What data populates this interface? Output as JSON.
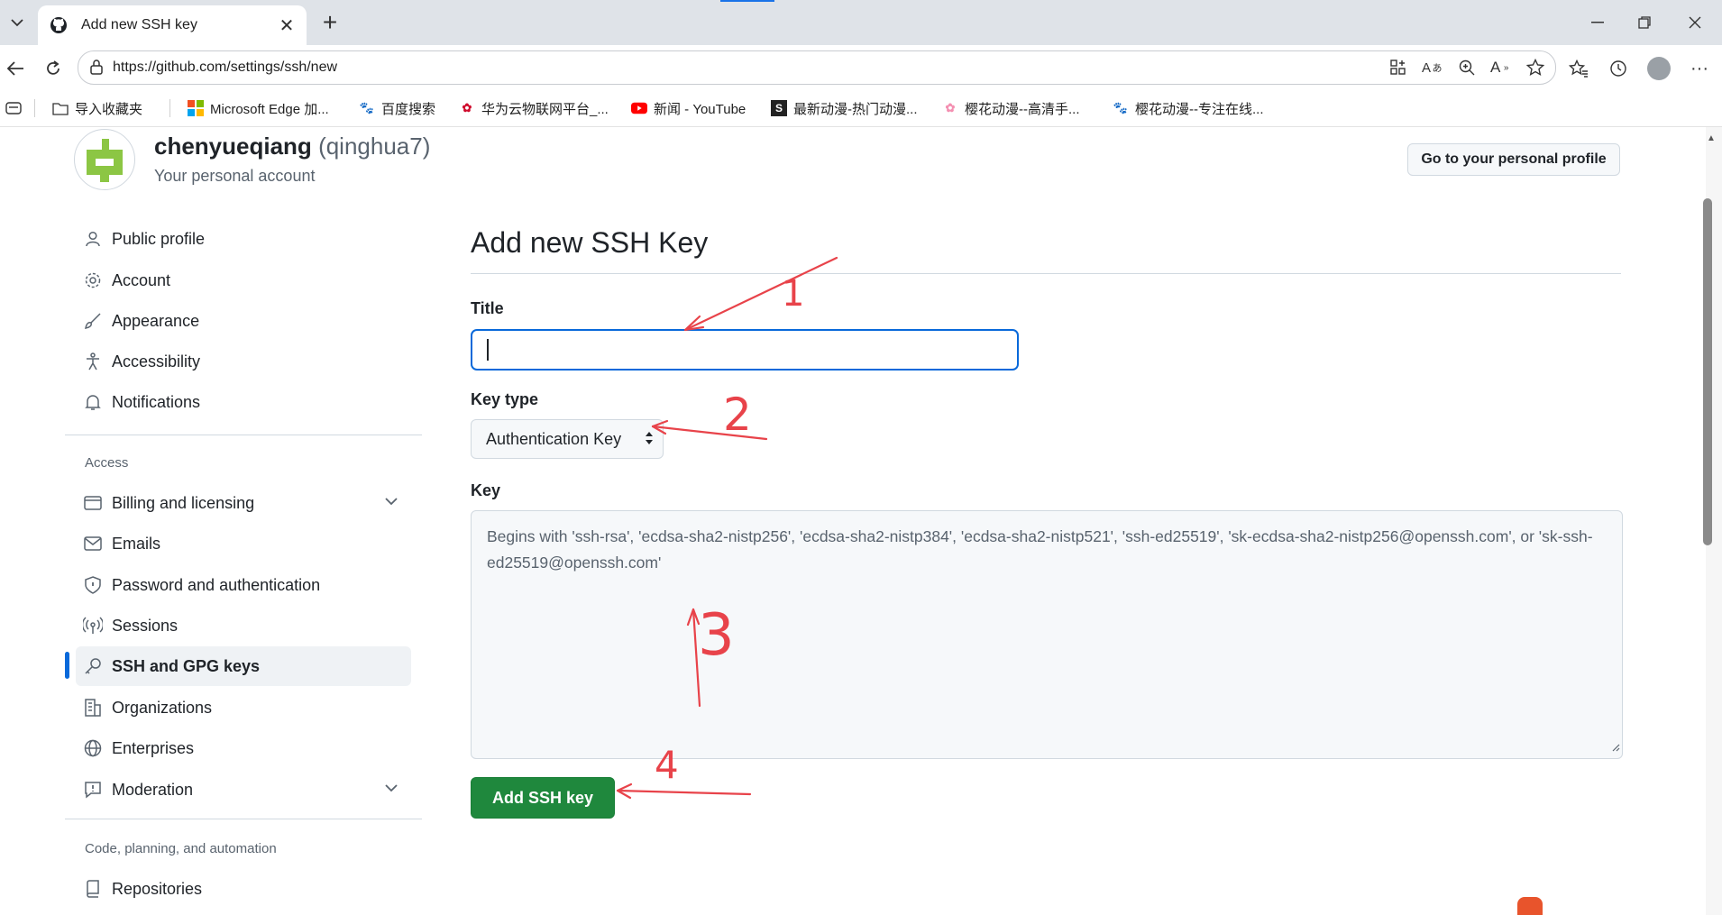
{
  "browser": {
    "tab_title": "Add new SSH key",
    "url": "https://github.com/settings/ssh/new",
    "favorites": [
      {
        "label": "导入收藏夹"
      },
      {
        "label": "Microsoft Edge 加..."
      },
      {
        "label": "百度搜索"
      },
      {
        "label": "华为云物联网平台_..."
      },
      {
        "label": "新闻 - YouTube"
      },
      {
        "label": "最新动漫-热门动漫..."
      },
      {
        "label": "樱花动漫--高清手..."
      },
      {
        "label": "樱花动漫--专注在线..."
      }
    ]
  },
  "account": {
    "name": "chenyueqiang",
    "login": "(qinghua7)",
    "subtitle": "Your personal account",
    "profile_button": "Go to your personal profile"
  },
  "sidebar": {
    "top_items": [
      {
        "label": "Public profile",
        "icon": "person-icon"
      },
      {
        "label": "Account",
        "icon": "gear-icon"
      },
      {
        "label": "Appearance",
        "icon": "paintbrush-icon"
      },
      {
        "label": "Accessibility",
        "icon": "accessibility-icon"
      },
      {
        "label": "Notifications",
        "icon": "bell-icon"
      }
    ],
    "access_heading": "Access",
    "access_items": [
      {
        "label": "Billing and licensing",
        "icon": "credit-card-icon"
      },
      {
        "label": "Emails",
        "icon": "mail-icon"
      },
      {
        "label": "Password and authentication",
        "icon": "shield-icon"
      },
      {
        "label": "Sessions",
        "icon": "broadcast-icon"
      },
      {
        "label": "SSH and GPG keys",
        "icon": "key-icon",
        "active": true
      },
      {
        "label": "Organizations",
        "icon": "organization-icon"
      },
      {
        "label": "Enterprises",
        "icon": "globe-icon"
      },
      {
        "label": "Moderation",
        "icon": "report-icon"
      }
    ],
    "code_heading": "Code, planning, and automation",
    "code_items": [
      {
        "label": "Repositories",
        "icon": "repo-icon"
      }
    ]
  },
  "form": {
    "heading": "Add new SSH Key",
    "title_label": "Title",
    "title_value": "",
    "keytype_label": "Key type",
    "keytype_value": "Authentication Key",
    "key_label": "Key",
    "key_placeholder": "Begins with 'ssh-rsa', 'ecdsa-sha2-nistp256', 'ecdsa-sha2-nistp384', 'ecdsa-sha2-nistp521', 'ssh-ed25519', 'sk-ecdsa-sha2-nistp256@openssh.com', or 'sk-ssh-ed25519@openssh.com'",
    "submit": "Add SSH key"
  },
  "annotations": [
    {
      "number": "1"
    },
    {
      "number": "2"
    },
    {
      "number": "3"
    },
    {
      "number": "4"
    }
  ],
  "colors": {
    "accent_blue": "#0969da",
    "primary_green": "#1f883d",
    "annotation_red": "#e8434a"
  }
}
